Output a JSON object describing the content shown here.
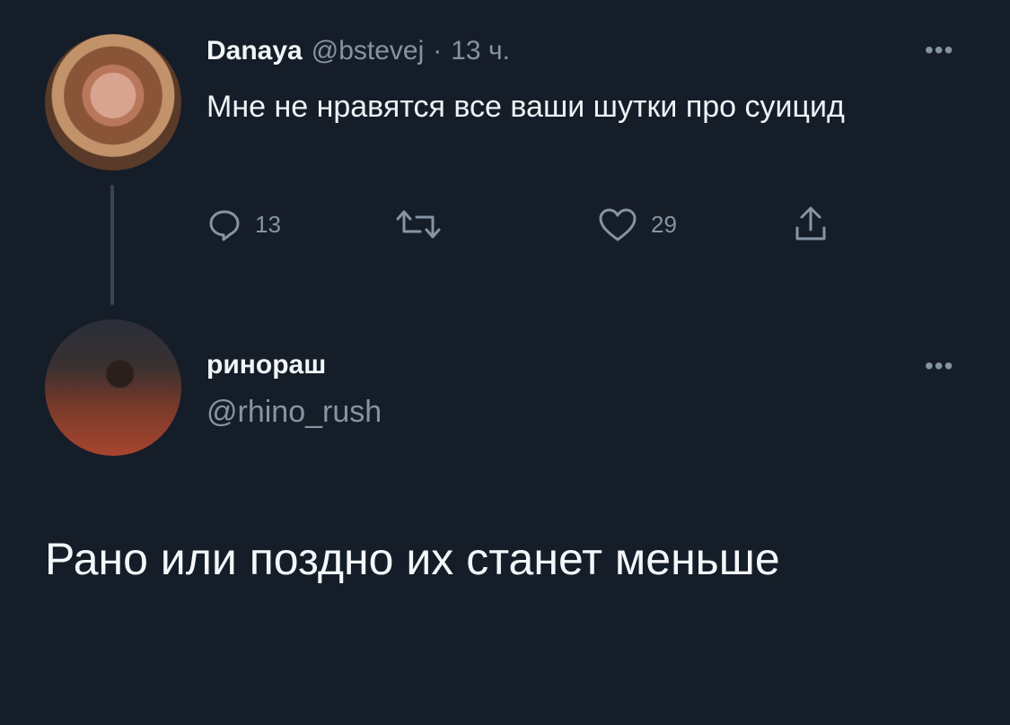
{
  "tweet": {
    "display_name": "Danaya",
    "handle": "@bstevej",
    "separator": "·",
    "time": "13 ч.",
    "text": "Мне не нравятся все ваши шутки про суицид",
    "more_label": "•••",
    "replies_count": "13",
    "likes_count": "29",
    "icons": [
      "reply-icon",
      "retweet-icon",
      "like-icon",
      "share-icon"
    ]
  },
  "reply": {
    "display_name": "ринораш",
    "handle": "@rhino_rush",
    "more_label": "•••",
    "text": "Рано или поздно их станет меньше"
  },
  "colors": {
    "background": "#151d28",
    "text": "#e8edf1",
    "muted": "#8594a3",
    "thread_line": "#3a4250"
  }
}
